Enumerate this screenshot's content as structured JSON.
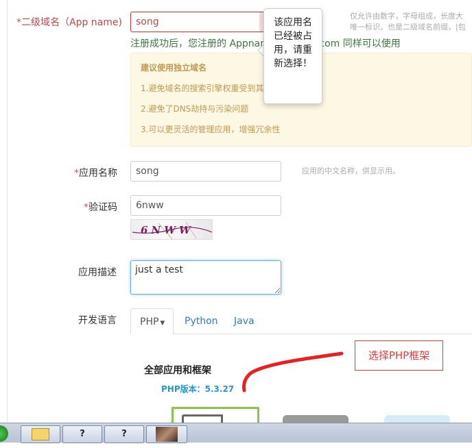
{
  "form": {
    "app_name": {
      "required_mark": "*",
      "label": "二级域名（App name)",
      "value": "song",
      "hint": "仅允许由数字，字母组成，长度大\n唯一标识，也是二级域名前缀，|包",
      "note": "注册成功后，您注册的 Appname.sinaapp.com 同样可以使用",
      "error_popover": "该应用名已经被占用，请重新选择！"
    },
    "suggestion": {
      "title": "建议使用独立域名",
      "items": [
        "1.避免域名的搜索引擎权重受到其它应用的影响",
        "2.避免了DNS劫持与污染问题",
        "3.可以更灵活的管理应用，增强冗余性"
      ]
    },
    "display_name": {
      "required_mark": "*",
      "label": "应用名称",
      "value": "song",
      "hint": "应用的中文名称，供显示用。"
    },
    "captcha": {
      "required_mark": "*",
      "label": "验证码",
      "value": "6nww",
      "image_text": "6NWW"
    },
    "description": {
      "label": "应用描述",
      "value": "just a test"
    },
    "language": {
      "label": "开发语言",
      "tabs": [
        {
          "label": "PHP",
          "active": true,
          "dropdown": true
        },
        {
          "label": "Python",
          "active": false
        },
        {
          "label": "Java",
          "active": false
        }
      ]
    },
    "frameworks": {
      "heading": "全部应用和框架",
      "php_version_label": "PHP版本：5.3.27"
    }
  },
  "annotation": {
    "callout_text": "选择PHP框架",
    "color": "#e03c3c"
  },
  "taskbar": {
    "buttons": [
      "?",
      "?"
    ]
  },
  "colors": {
    "error": "#b94a48",
    "success": "#3c763d",
    "warning_bg": "#fcf8e3",
    "link": "#337ab7",
    "php_version": "#2a93d5"
  }
}
